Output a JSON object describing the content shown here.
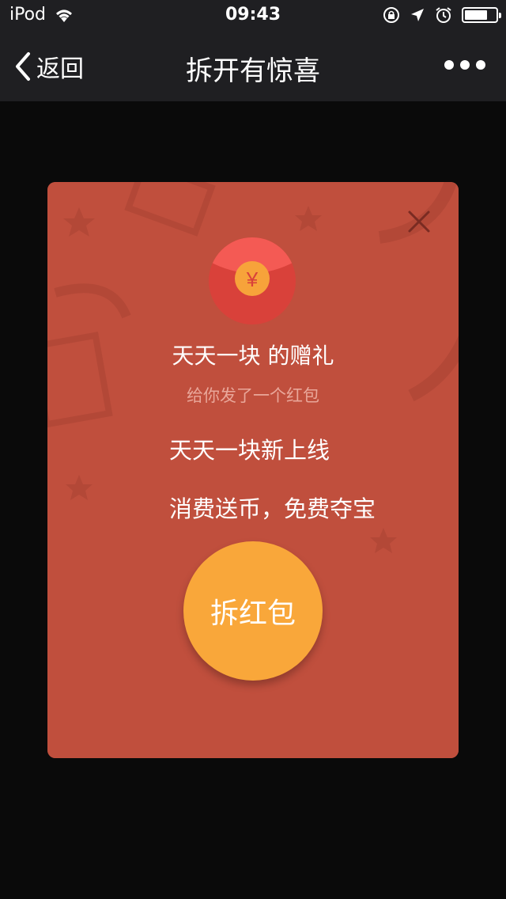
{
  "status_bar": {
    "carrier": "iPod",
    "time": "09:43",
    "icons": [
      "wifi-icon",
      "orientation-lock-icon",
      "location-icon",
      "alarm-icon",
      "battery-icon"
    ]
  },
  "nav": {
    "back_label": "返回",
    "title": "拆开有惊喜",
    "more_icon": "more-icon"
  },
  "red_packet": {
    "sender_title": "天天一块 的赠礼",
    "subtitle": "给你发了一个红包",
    "message_line1": "天天一块新上线",
    "message_line2": "消费送币，免费夺宝",
    "open_button_label": "拆红包",
    "avatar_symbol": "¥",
    "close_icon": "close-icon"
  },
  "colors": {
    "status_nav_bg": "#1f1f22",
    "page_bg": "#0a0a0a",
    "packet_top": "#c04f3d",
    "packet_bottom": "#a5463a",
    "open_button": "#f9a73a",
    "subtitle_text": "#e9a79a"
  }
}
